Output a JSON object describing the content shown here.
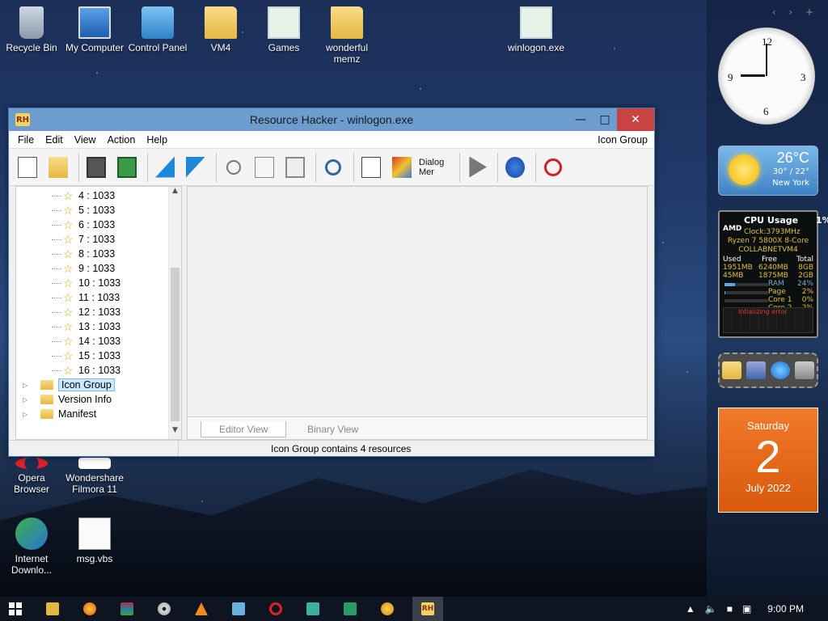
{
  "desktop_icons": [
    {
      "label": "Recycle Bin"
    },
    {
      "label": "My Computer"
    },
    {
      "label": "Control Panel"
    },
    {
      "label": "VM4"
    },
    {
      "label": "Games"
    },
    {
      "label": "wonderful memz"
    },
    {
      "label": "winlogon.exe"
    },
    {
      "label": "Opera Browser"
    },
    {
      "label": "Wondershare Filmora 11"
    },
    {
      "label": "Internet Downlo..."
    },
    {
      "label": "msg.vbs"
    }
  ],
  "window": {
    "title": "Resource Hacker - winlogon.exe",
    "logo_text": "RH",
    "menu": [
      "File",
      "Edit",
      "View",
      "Action",
      "Help"
    ],
    "menu_right": "Icon Group",
    "toolbar_dialog_label": "Dialog Mer"
  },
  "tree": {
    "leaves": [
      "4 : 1033",
      "5 : 1033",
      "6 : 1033",
      "7 : 1033",
      "8 : 1033",
      "9 : 1033",
      "10 : 1033",
      "11 : 1033",
      "12 : 1033",
      "13 : 1033",
      "14 : 1033",
      "15 : 1033",
      "16 : 1033"
    ],
    "folders": [
      "Icon Group",
      "Version Info",
      "Manifest"
    ]
  },
  "editor": {
    "tab_editor": "Editor View",
    "tab_binary": "Binary View"
  },
  "status": {
    "message": "Icon Group contains 4 resources"
  },
  "gadgets": {
    "weather": {
      "temp": "26°C",
      "range": "30° / 22°",
      "city": "New York"
    },
    "cpu": {
      "title": "CPU Usage",
      "percent": "1%",
      "brand": "AMD",
      "clock": "Clock:3793MHz",
      "model": "Ryzen 7 5800X 8-Core",
      "host": "COLLABNETVM4",
      "hdr_used": "Used",
      "hdr_free": "Free",
      "hdr_total": "Total",
      "mem1": {
        "used": "1951MB",
        "free": "6240MB",
        "total": "8GB"
      },
      "mem2": {
        "used": "45MB",
        "free": "1875MB",
        "total": "2GB"
      },
      "ram": {
        "label": "RAM",
        "value": "24%",
        "level": 24
      },
      "page": {
        "label": "Page",
        "value": "2%",
        "level": 2
      },
      "core1": {
        "label": "Core 1",
        "value": "0%",
        "level": 0
      },
      "core2": {
        "label": "Core 2",
        "value": "2%",
        "level": 2
      },
      "graph_error": "Intializing error"
    },
    "calendar": {
      "weekday": "Saturday",
      "day": "2",
      "month_year": "July 2022"
    }
  },
  "taskbar": {
    "active_label": "RH",
    "time": "9:00 PM"
  }
}
